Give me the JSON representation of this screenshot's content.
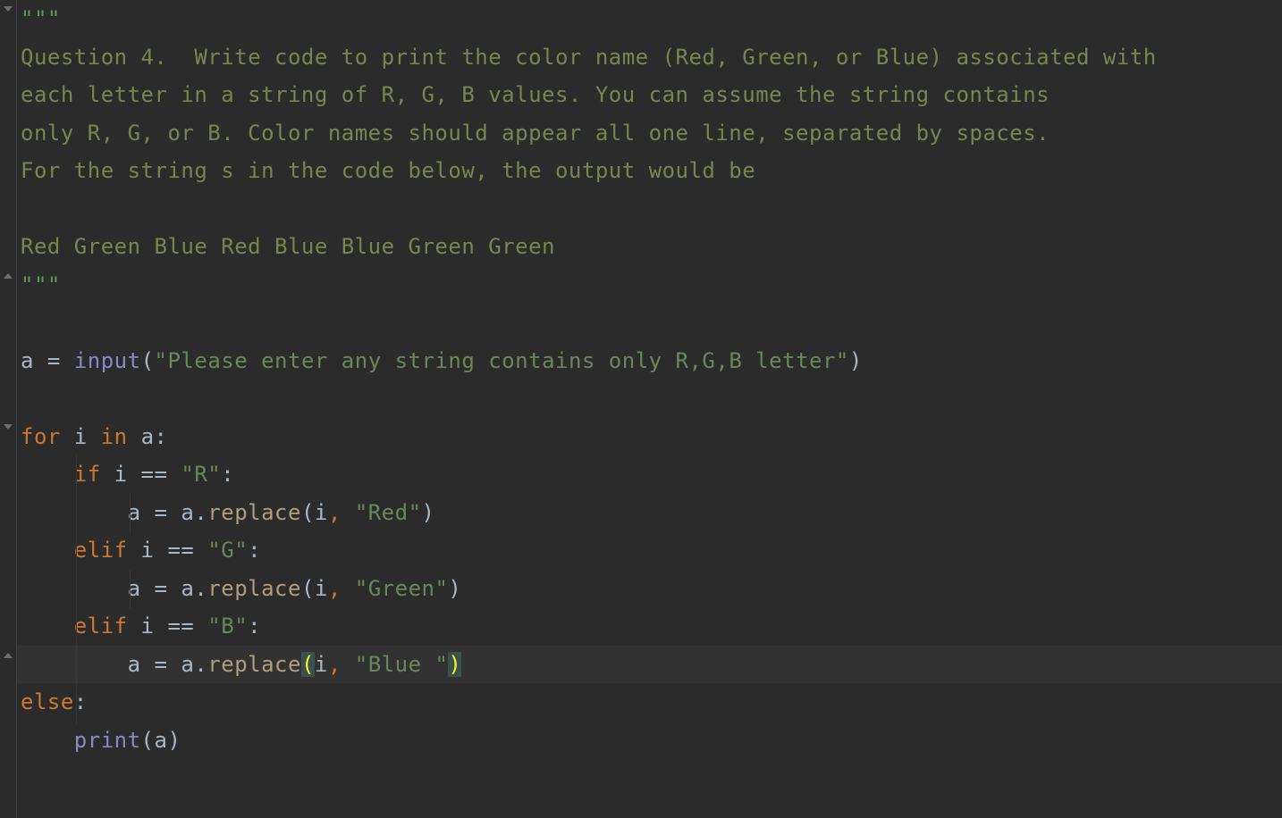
{
  "colors": {
    "background": "#2b2b2b",
    "foreground": "#a9b7c6",
    "doc": "#77864f",
    "keyword": "#cc7832",
    "builtin": "#8888c6",
    "string": "#6a8759",
    "current_line": "#323232",
    "match_bg": "#3b514d",
    "match_fg": "#ffef28",
    "gutter_border": "#3c3f41",
    "fold_icon": "#6e6e6e"
  },
  "gutter": {
    "fold_open_top": true,
    "fold_close_mid": true,
    "fold_open_for": true,
    "fold_close_cur": true
  },
  "code": {
    "l1": "\"\"\"",
    "l2": "Question 4.  Write code to print the color name (Red, Green, or Blue) associated with",
    "l3": "each letter in a string of R, G, B values. You can assume the string contains",
    "l4": "only R, G, or B. Color names should appear all one line, separated by spaces.",
    "l5": "For the string s in the code below, the output would be",
    "l6": "",
    "l7": "Red Green Blue Red Blue Blue Green Green",
    "l8": "\"\"\"",
    "l9": "",
    "l10_var": "a",
    "l10_eq": " = ",
    "l10_fn": "input",
    "l10_open": "(",
    "l10_str": "\"Please enter any string contains only R,G,B letter\"",
    "l10_close": ")",
    "l11": "",
    "l12_kw1": "for",
    "l12_sp1": " ",
    "l12_v": "i",
    "l12_sp2": " ",
    "l12_kw2": "in",
    "l12_sp3": " ",
    "l12_v2": "a:",
    "l13_indent": "    ",
    "l13_kw": "if",
    "l13_rest_pre": " i == ",
    "l13_str": "\"R\"",
    "l13_colon": ":",
    "l14_indent": "        ",
    "l14_a": "a = a.",
    "l14_fn": "replace",
    "l14_open": "(",
    "l14_arg1": "i",
    "l14_comma": ", ",
    "l14_str": "\"Red\"",
    "l14_close": ")",
    "l15_indent": "    ",
    "l15_kw": "elif",
    "l15_rest_pre": " i == ",
    "l15_str": "\"G\"",
    "l15_colon": ":",
    "l16_indent": "        ",
    "l16_a": "a = a.",
    "l16_fn": "replace",
    "l16_open": "(",
    "l16_arg1": "i",
    "l16_comma": ", ",
    "l16_str": "\"Green\"",
    "l16_close": ")",
    "l17_indent": "    ",
    "l17_kw": "elif",
    "l17_rest_pre": " i == ",
    "l17_str": "\"B\"",
    "l17_colon": ":",
    "l18_indent": "        ",
    "l18_a": "a = a.",
    "l18_fn": "replace",
    "l18_open": "(",
    "l18_arg1": "i",
    "l18_comma": ", ",
    "l18_str": "\"Blue \"",
    "l18_close": ")",
    "l19_kw": "else",
    "l19_colon": ":",
    "l20_indent": "    ",
    "l20_fn": "print",
    "l20_open": "(",
    "l20_arg": "a",
    "l20_close": ")"
  }
}
